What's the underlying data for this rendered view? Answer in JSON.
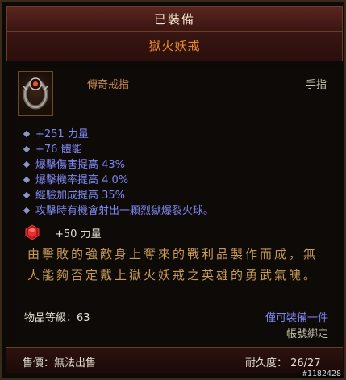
{
  "tooltip": {
    "header_label": "已裝備",
    "item_name": "獄火妖戒",
    "item_type": "傳奇戒指",
    "item_slot": "手指",
    "stats": [
      "+251 力量",
      "+76 體能",
      "爆擊傷害提高 43%",
      "爆擊機率提高 4.0%",
      "經驗加成提高 35%",
      "攻擊時有機會射出一顆烈獄爆裂火球。"
    ],
    "gem_bonus": "+50 力量",
    "flavor_text": "由擊敗的強敵身上奪來的戰利品製作而成，無人能夠否定戴上獄火妖戒之英雄的勇武氣魄。",
    "item_level": "物品等級：63",
    "bind_line1": "僅可裝備一件",
    "bind_line2": "帳號綁定",
    "sell_text": "售價：無法出售",
    "durability": "耐久度：  26/27"
  },
  "watermark": "#1182428",
  "colors": {
    "item_name": "#e88a2e",
    "magic_stat": "#7f86f0",
    "flavor": "#c89a55"
  }
}
